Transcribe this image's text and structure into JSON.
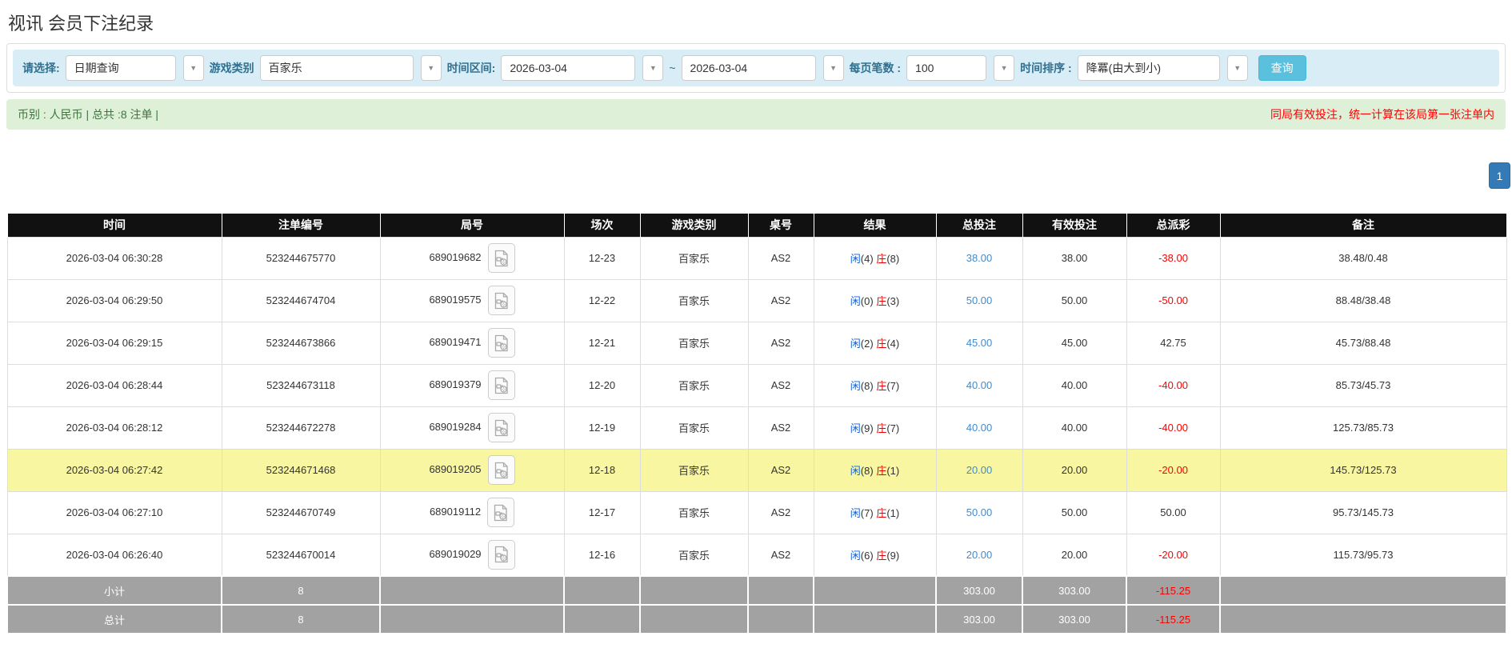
{
  "page": {
    "title": "视讯 会员下注纪录"
  },
  "filters": {
    "select_label": "请选择:",
    "select_value": "日期查询",
    "game_type_label": "游戏类别",
    "game_type_value": "百家乐",
    "time_range_label": "时间区间:",
    "date_from": "2026-03-04",
    "tilde": "~",
    "date_to": "2026-03-04",
    "page_size_label": "每页笔数 :",
    "page_size_value": "100",
    "sort_label": "时间排序 :",
    "sort_value": "降冪(由大到小)",
    "search_button": "查询"
  },
  "summary": {
    "left": "币别 : 人民币 | 总共 :8 注单 |",
    "right": "同局有效投注，统一计算在该局第一张注单内"
  },
  "pagination": {
    "current": "1"
  },
  "icons": {
    "dropdown_caret": "▼",
    "video_icon_name": "video-replay-icon"
  },
  "colors": {
    "filter_bar_bg": "#d9edf7",
    "filter_label": "#31708f",
    "search_button_bg": "#5bc0de",
    "summary_bg": "#dff0d8",
    "summary_text": "#3c763d",
    "warning_text": "#ff0000",
    "pager_bg": "#337ab7",
    "header_bg": "#111111",
    "highlight_row_bg": "#f8f6a0",
    "total_row_bg": "#a2a2a2",
    "link_blue": "#428bca",
    "player_blue": "#0b62e0",
    "banker_red": "#e60000"
  },
  "table": {
    "headers": [
      "时间",
      "注单编号",
      "局号",
      "场次",
      "游戏类别",
      "桌号",
      "结果",
      "总投注",
      "有效投注",
      "总派彩",
      "备注"
    ],
    "rows": [
      {
        "time": "2026-03-04 06:30:28",
        "bet_id": "523244675770",
        "round_id": "689019682",
        "session": "12-23",
        "game": "百家乐",
        "table_no": "AS2",
        "player_char": "闲",
        "player_num": "(4)",
        "banker_char": "庄",
        "banker_num": "(8)",
        "total_bet": "38.00",
        "valid_bet": "38.00",
        "payout": "-38.00",
        "note": "38.48/0.48",
        "highlight": false
      },
      {
        "time": "2026-03-04 06:29:50",
        "bet_id": "523244674704",
        "round_id": "689019575",
        "session": "12-22",
        "game": "百家乐",
        "table_no": "AS2",
        "player_char": "闲",
        "player_num": "(0)",
        "banker_char": "庄",
        "banker_num": "(3)",
        "total_bet": "50.00",
        "valid_bet": "50.00",
        "payout": "-50.00",
        "note": "88.48/38.48",
        "highlight": false
      },
      {
        "time": "2026-03-04 06:29:15",
        "bet_id": "523244673866",
        "round_id": "689019471",
        "session": "12-21",
        "game": "百家乐",
        "table_no": "AS2",
        "player_char": "闲",
        "player_num": "(2)",
        "banker_char": "庄",
        "banker_num": "(4)",
        "total_bet": "45.00",
        "valid_bet": "45.00",
        "payout": "42.75",
        "note": "45.73/88.48",
        "highlight": false
      },
      {
        "time": "2026-03-04 06:28:44",
        "bet_id": "523244673118",
        "round_id": "689019379",
        "session": "12-20",
        "game": "百家乐",
        "table_no": "AS2",
        "player_char": "闲",
        "player_num": "(8)",
        "banker_char": "庄",
        "banker_num": "(7)",
        "total_bet": "40.00",
        "valid_bet": "40.00",
        "payout": "-40.00",
        "note": "85.73/45.73",
        "highlight": false
      },
      {
        "time": "2026-03-04 06:28:12",
        "bet_id": "523244672278",
        "round_id": "689019284",
        "session": "12-19",
        "game": "百家乐",
        "table_no": "AS2",
        "player_char": "闲",
        "player_num": "(9)",
        "banker_char": "庄",
        "banker_num": "(7)",
        "total_bet": "40.00",
        "valid_bet": "40.00",
        "payout": "-40.00",
        "note": "125.73/85.73",
        "highlight": false
      },
      {
        "time": "2026-03-04 06:27:42",
        "bet_id": "523244671468",
        "round_id": "689019205",
        "session": "12-18",
        "game": "百家乐",
        "table_no": "AS2",
        "player_char": "闲",
        "player_num": "(8)",
        "banker_char": "庄",
        "banker_num": "(1)",
        "total_bet": "20.00",
        "valid_bet": "20.00",
        "payout": "-20.00",
        "note": "145.73/125.73",
        "highlight": true
      },
      {
        "time": "2026-03-04 06:27:10",
        "bet_id": "523244670749",
        "round_id": "689019112",
        "session": "12-17",
        "game": "百家乐",
        "table_no": "AS2",
        "player_char": "闲",
        "player_num": "(7)",
        "banker_char": "庄",
        "banker_num": "(1)",
        "total_bet": "50.00",
        "valid_bet": "50.00",
        "payout": "50.00",
        "note": "95.73/145.73",
        "highlight": false
      },
      {
        "time": "2026-03-04 06:26:40",
        "bet_id": "523244670014",
        "round_id": "689019029",
        "session": "12-16",
        "game": "百家乐",
        "table_no": "AS2",
        "player_char": "闲",
        "player_num": "(6)",
        "banker_char": "庄",
        "banker_num": "(9)",
        "total_bet": "20.00",
        "valid_bet": "20.00",
        "payout": "-20.00",
        "note": "115.73/95.73",
        "highlight": false
      }
    ],
    "footer": [
      {
        "label": "小计",
        "count": "8",
        "total_bet": "303.00",
        "valid_bet": "303.00",
        "payout": "-115.25"
      },
      {
        "label": "总计",
        "count": "8",
        "total_bet": "303.00",
        "valid_bet": "303.00",
        "payout": "-115.25"
      }
    ]
  }
}
